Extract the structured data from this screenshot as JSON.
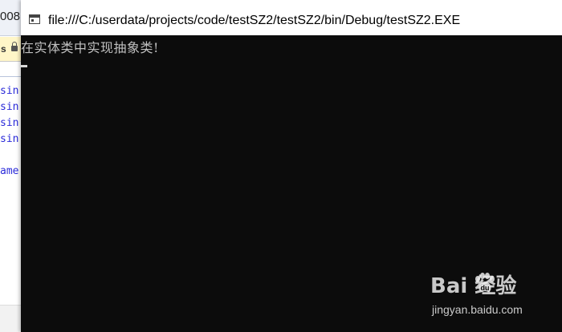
{
  "background_editor": {
    "tab_text": "008",
    "info_bar_text": "s",
    "code_lines": [
      "sin",
      "sin",
      "sin",
      "sin",
      "ame"
    ]
  },
  "console_window": {
    "title": "file:///C:/userdata/projects/code/testSZ2/testSZ2/bin/Debug/testSZ2.EXE",
    "output_line": "在实体类中实现抽象类!",
    "background_color": "#0c0c0c",
    "text_color": "#c0c0c0"
  },
  "watermark": {
    "brand_text": "Bai  经验",
    "url": "jingyan.baidu.com"
  }
}
